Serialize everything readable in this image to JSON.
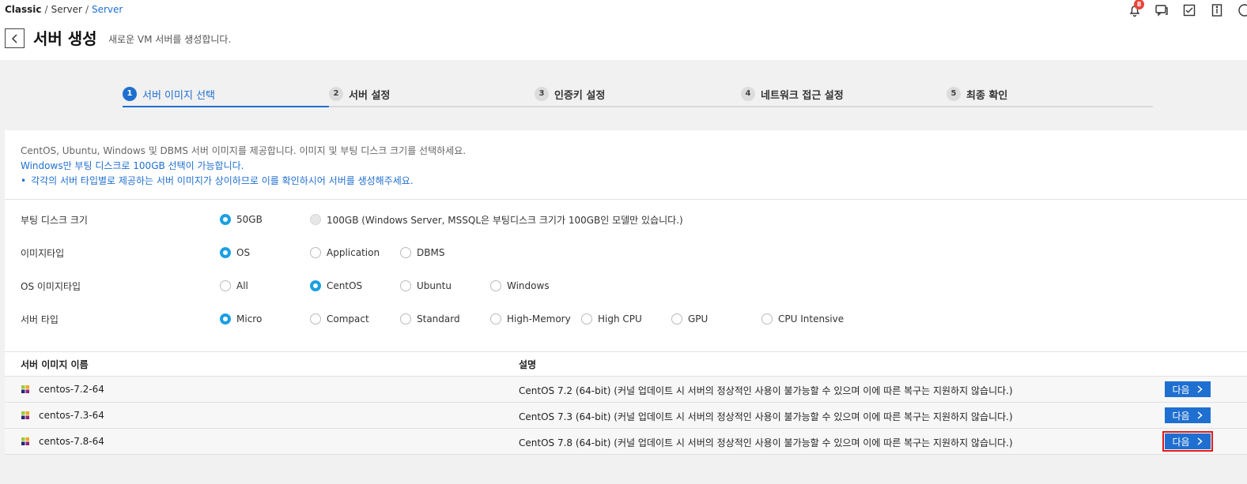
{
  "breadcrumb": {
    "root": "Classic",
    "sep1": "/",
    "mid": "Server",
    "sep2": "/",
    "current": "Server"
  },
  "header": {
    "notif_count": "8",
    "title": "서버 생성",
    "subtitle": "새로운 VM 서버를 생성합니다."
  },
  "steps": [
    {
      "num": "1",
      "label": "서버 이미지 선택"
    },
    {
      "num": "2",
      "label": "서버 설정"
    },
    {
      "num": "3",
      "label": "인증키 설정"
    },
    {
      "num": "4",
      "label": "네트워크 접근 설정"
    },
    {
      "num": "5",
      "label": "최종 확인"
    }
  ],
  "info": {
    "line1": "CentOS, Ubuntu, Windows 및 DBMS 서버 이미지를 제공합니다. 이미지 및 부팅 디스크 크기를 선택하세요.",
    "line2": "Windows만 부팅 디스크로 100GB 선택이 가능합니다.",
    "bullet": "•",
    "line3": "각각의 서버 타입별로 제공하는 서버 이미지가 상이하므로 이를 확인하시어 서버를 생성해주세요."
  },
  "options": {
    "boot_disk": {
      "label": "부팅 디스크 크기",
      "opts": [
        "50GB",
        "100GB (Windows Server, MSSQL은 부팅디스크 크기가 100GB인 모델만 있습니다.)"
      ]
    },
    "image_type": {
      "label": "이미지타입",
      "opts": [
        "OS",
        "Application",
        "DBMS"
      ]
    },
    "os_image_type": {
      "label": "OS 이미지타입",
      "opts": [
        "All",
        "CentOS",
        "Ubuntu",
        "Windows"
      ]
    },
    "server_type": {
      "label": "서버 타입",
      "opts": [
        "Micro",
        "Compact",
        "Standard",
        "High-Memory",
        "High CPU",
        "GPU",
        "CPU Intensive"
      ]
    }
  },
  "table": {
    "col_name": "서버 이미지 이름",
    "col_desc": "설명",
    "next_label": "다음",
    "rows": [
      {
        "name": "centos-7.2-64",
        "desc": "CentOS 7.2 (64-bit) (커널 업데이트 시 서버의 정상적인 사용이 불가능할 수 있으며 이에 따른 복구는 지원하지 않습니다.)"
      },
      {
        "name": "centos-7.3-64",
        "desc": "CentOS 7.3 (64-bit) (커널 업데이트 시 서버의 정상적인 사용이 불가능할 수 있으며 이에 따른 복구는 지원하지 않습니다.)"
      },
      {
        "name": "centos-7.8-64",
        "desc": "CentOS 7.8 (64-bit) (커널 업데이트 시 서버의 정상적인 사용이 불가능할 수 있으며 이에 따른 복구는 지원하지 않습니다.)"
      }
    ]
  },
  "colors": {
    "accent": "#1f6fd1",
    "radio": "#1ba0e2",
    "highlight": "#e21b1b",
    "badge": "#e8453c"
  }
}
